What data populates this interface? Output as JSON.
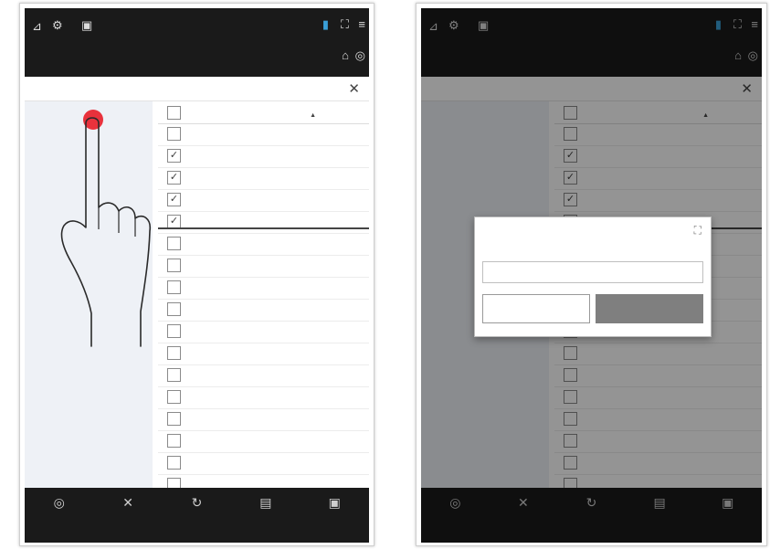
{
  "app": {
    "title": "",
    "topbar_icons": [
      "signal-icon",
      "settings-icon",
      "camera-icon",
      "battery-icon",
      "expand-icon",
      "menu-icon",
      "sub-icon-a",
      "sub-icon-b"
    ]
  },
  "panel": {
    "title": "",
    "close_symbol": "✕"
  },
  "sidebar": {
    "add_group_label": ""
  },
  "table": {
    "header_name": "",
    "header_state": "",
    "rows": [
      {
        "name": "",
        "state": "",
        "checked": false
      },
      {
        "name": "",
        "state": "",
        "checked": true
      },
      {
        "name": "",
        "state": "",
        "checked": true
      },
      {
        "name": "",
        "state": "",
        "checked": true
      },
      {
        "name": "",
        "state": "",
        "checked": true
      },
      {
        "name": "",
        "state": "",
        "checked": false
      },
      {
        "name": "",
        "state": "",
        "checked": false
      },
      {
        "name": "",
        "state": "",
        "checked": false
      },
      {
        "name": "",
        "state": "",
        "checked": false
      },
      {
        "name": "",
        "state": "",
        "checked": false
      },
      {
        "name": "",
        "state": "",
        "checked": false
      },
      {
        "name": "",
        "state": "",
        "checked": false
      },
      {
        "name": "",
        "state": "",
        "checked": false
      },
      {
        "name": "",
        "state": "",
        "checked": false
      },
      {
        "name": "",
        "state": "",
        "checked": false
      },
      {
        "name": "",
        "state": "",
        "checked": false
      },
      {
        "name": "",
        "state": "",
        "checked": false
      },
      {
        "name": "",
        "state": "",
        "checked": false
      },
      {
        "name": "",
        "state": "",
        "checked": false
      },
      {
        "name": "",
        "state": "",
        "checked": false
      }
    ]
  },
  "bottombar": {
    "items": [
      {
        "icon": "target-icon",
        "label": ""
      },
      {
        "icon": "clear-icon",
        "label": ""
      },
      {
        "icon": "refresh-icon",
        "label": ""
      },
      {
        "icon": "favorites-icon",
        "label": ""
      },
      {
        "icon": "save-data-icon",
        "label": ""
      }
    ]
  },
  "dialog": {
    "title": "",
    "field_label": "",
    "field_placeholder": "",
    "cancel_label": "",
    "save_label": ""
  },
  "colors": {
    "bar_bg": "#1a1a1a",
    "sidebar_bg": "#eef1f6",
    "link_blue": "#2c4f9e",
    "touch_red": "#e8323c",
    "save_button_bg": "#7f7f7f"
  }
}
